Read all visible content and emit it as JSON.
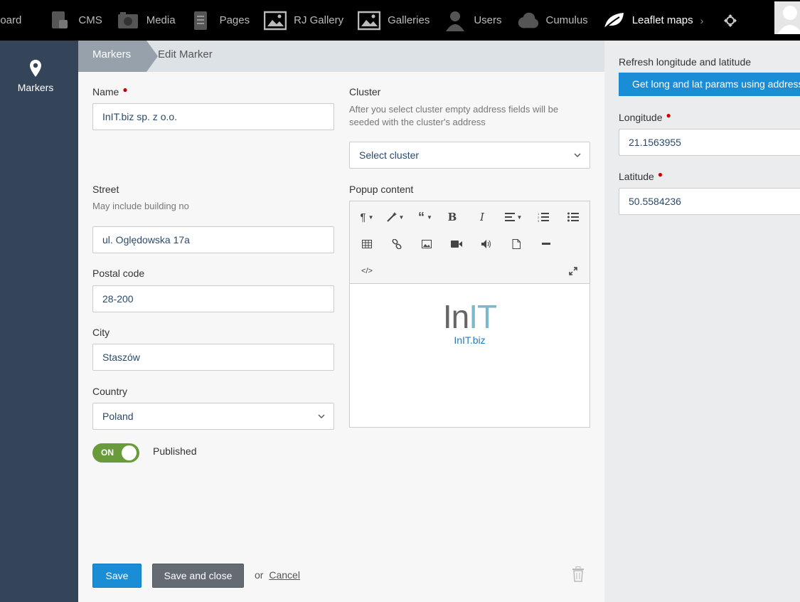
{
  "nav": {
    "items": [
      {
        "label": "board",
        "icon": "dashboard-icon"
      },
      {
        "label": "CMS",
        "icon": "cms-icon"
      },
      {
        "label": "Media",
        "icon": "media-icon"
      },
      {
        "label": "Pages",
        "icon": "pages-icon"
      },
      {
        "label": "RJ Gallery",
        "icon": "gallery-icon"
      },
      {
        "label": "Galleries",
        "icon": "galleries-icon"
      },
      {
        "label": "Users",
        "icon": "users-icon"
      },
      {
        "label": "Cumulus",
        "icon": "cloud-icon"
      },
      {
        "label": "Leaflet maps",
        "icon": "leaf-icon"
      }
    ],
    "chevron": "›"
  },
  "sidebar": {
    "markers_label": "Markers"
  },
  "breadcrumb": {
    "parent": "Markers",
    "current": "Edit Marker"
  },
  "form": {
    "name": {
      "label": "Name",
      "value": "InIT.biz sp. z o.o."
    },
    "cluster": {
      "label": "Cluster",
      "help": "After you select cluster empty address fields will be seeded with the cluster's address",
      "value": "Select cluster"
    },
    "street": {
      "label": "Street",
      "help": "May include building no",
      "value": "ul. Oględowska 17a"
    },
    "postal": {
      "label": "Postal code",
      "value": "28-200"
    },
    "city": {
      "label": "City",
      "value": "Staszów"
    },
    "country": {
      "label": "Country",
      "value": "Poland"
    },
    "published": {
      "toggle": "ON",
      "label": "Published"
    },
    "popup": {
      "label": "Popup content",
      "logo_in": "In",
      "logo_it": "IT",
      "link": "InIT.biz"
    }
  },
  "actions": {
    "save": "Save",
    "save_close": "Save and close",
    "or": "or",
    "cancel": "Cancel"
  },
  "right": {
    "refresh_label": "Refresh longitude and latitude",
    "geo_button": "Get long and lat params using address",
    "longitude": {
      "label": "Longitude",
      "value": "21.1563955"
    },
    "latitude": {
      "label": "Latitude",
      "value": "50.5584236"
    }
  },
  "colors": {
    "primary": "#1a8dd6",
    "sidebar": "#344459",
    "toggle_on": "#6a9b3b",
    "required": "#cc0000"
  }
}
